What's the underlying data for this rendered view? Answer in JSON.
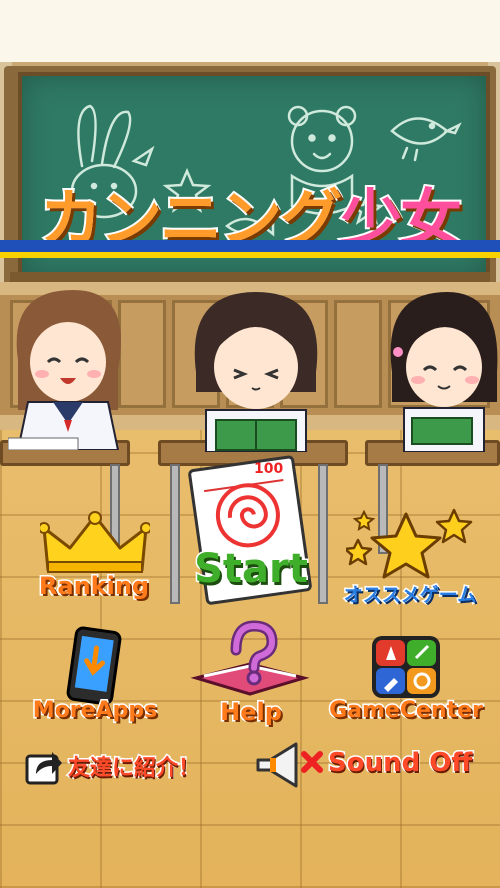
{
  "title": {
    "main": "カンニング",
    "accent": "少女"
  },
  "paper": {
    "score": "100"
  },
  "menu": {
    "ranking": "Ranking",
    "start": "Start",
    "osusume": "オススメゲーム",
    "more_apps": "MoreApps",
    "help": "Help",
    "game_center": "GameCenter",
    "share": "友達に紹介！",
    "sound": "Sound Off"
  },
  "colors": {
    "board": "#2f7a64",
    "title_orange": "#ff9b2b",
    "title_pink": "#ff4f9c",
    "start_green": "#3fae2a"
  }
}
